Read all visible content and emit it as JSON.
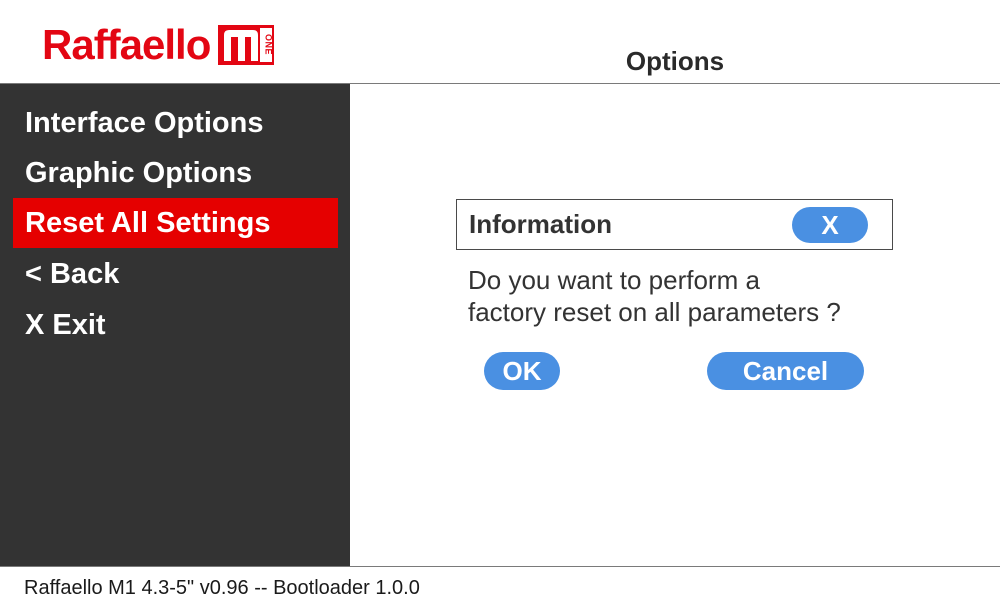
{
  "header": {
    "logo_text": "Raffaello",
    "logo_badge_text": "ONE",
    "title": "Options"
  },
  "sidebar": {
    "items": [
      {
        "label": "Interface Options",
        "active": false
      },
      {
        "label": "Graphic Options",
        "active": false
      },
      {
        "label": "Reset All Settings",
        "active": true
      },
      {
        "label": "< Back",
        "active": false
      },
      {
        "label": "X Exit",
        "active": false
      }
    ]
  },
  "dialog": {
    "title": "Information",
    "close_label": "X",
    "message_line1": "Do you want to perform a",
    "message_line2": "factory reset on all parameters ?",
    "ok_label": "OK",
    "cancel_label": "Cancel"
  },
  "footer": {
    "version_text": "Raffaello M1 4.3-5\" v0.96 -- Bootloader 1.0.0"
  },
  "colors": {
    "brand_red": "#e30613",
    "active_red": "#e50000",
    "sidebar_bg": "#333333",
    "button_blue": "#4a90e2"
  }
}
